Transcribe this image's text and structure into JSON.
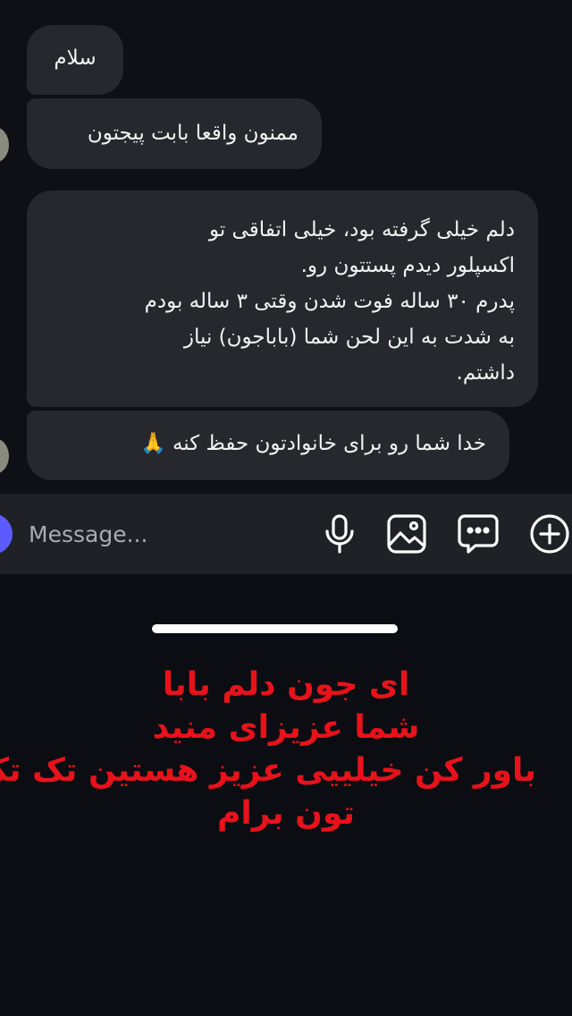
{
  "messages": [
    {
      "text": "سلام"
    },
    {
      "text": "ممنون واقعا بابت پیجتون"
    },
    {
      "lines": [
        "دلم خیلی گرفته بود، خیلی اتفاقی تو",
        "اکسپلور دیدم پستتون رو.",
        "پدرم ۳۰ ساله فوت شدن وقتی ۳ ساله بودم",
        "به شدت به این لحن شما (باباجون) نیاز",
        "داشتم."
      ]
    },
    {
      "text": "خدا شما رو برای خانوادتون حفظ کنه 🙏"
    }
  ],
  "composer": {
    "placeholder": "Message...",
    "icons": [
      "microphone-icon",
      "image-icon",
      "sticker-icon",
      "plus-circle-icon"
    ]
  },
  "caption": {
    "lines": [
      "ای جون دلم بابا",
      "شما عزیزای منید",
      "باور کن خیلییی عزیز هستین تک تک",
      "تون برام"
    ]
  },
  "colors": {
    "background": "#0b0d12",
    "bubble": "#26282e",
    "composer": "#1f2126",
    "caption": "#e8121b",
    "accent": "#5b5bff"
  }
}
